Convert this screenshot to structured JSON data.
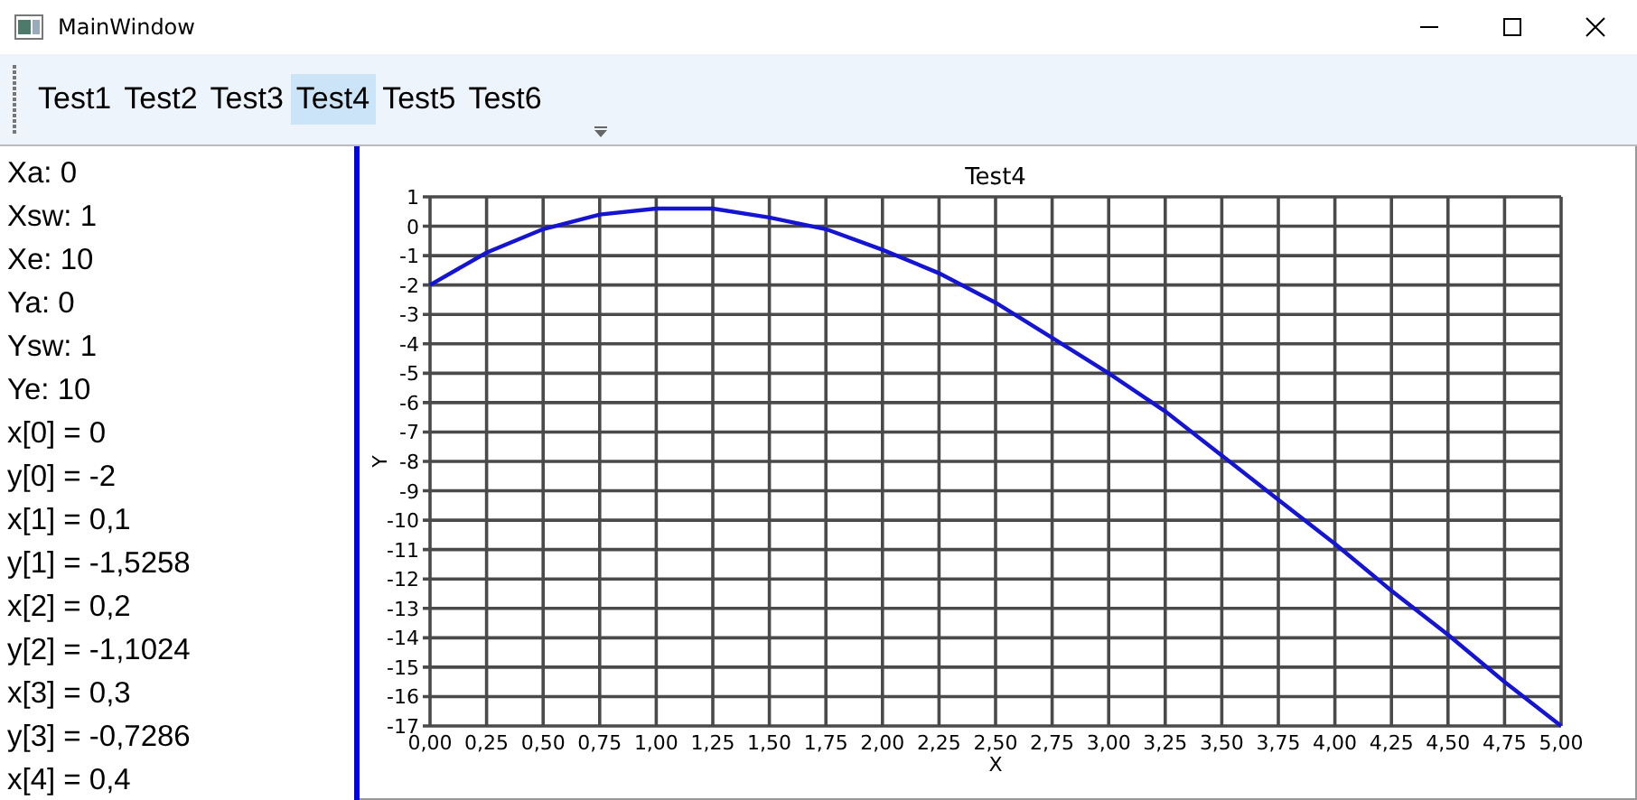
{
  "window": {
    "title": "MainWindow"
  },
  "toolbar": {
    "tabs": [
      {
        "label": "Test1",
        "selected": false
      },
      {
        "label": "Test2",
        "selected": false
      },
      {
        "label": "Test3",
        "selected": false
      },
      {
        "label": "Test4",
        "selected": true
      },
      {
        "label": "Test5",
        "selected": false
      },
      {
        "label": "Test6",
        "selected": false
      }
    ]
  },
  "variables": [
    "Xa: 0",
    "Xsw: 1",
    "Xe: 10",
    "Ya: 0",
    "Ysw: 1",
    "Ye: 10",
    "x[0] = 0",
    "y[0] = -2",
    "x[1] = 0,1",
    "y[1] = -1,5258",
    "x[2] = 0,2",
    "y[2] = -1,1024",
    "x[3] = 0,3",
    "y[3] = -0,7286",
    "x[4] = 0,4"
  ],
  "chart": {
    "chart_data": {
      "type": "line",
      "title": "Test4",
      "xlabel": "X",
      "ylabel": "Y",
      "x": [
        0,
        0.25,
        0.5,
        0.75,
        1,
        1.25,
        1.5,
        1.75,
        2,
        2.25,
        2.5,
        2.75,
        3,
        3.25,
        3.5,
        3.75,
        4,
        4.25,
        4.5,
        4.75,
        5
      ],
      "grid": true,
      "series": [
        {
          "color": "#1414d2",
          "values": [
            -2,
            -0.9,
            -0.1,
            0.4,
            0.6,
            0.6,
            0.3,
            -0.1,
            -0.8,
            -1.6,
            -2.6,
            -3.8,
            -5,
            -6.3,
            -7.8,
            -9.3,
            -10.8,
            -12.4,
            -13.9,
            -15.5,
            -17
          ]
        }
      ],
      "xlim": [
        0,
        5
      ],
      "ylim": [
        -17,
        1
      ],
      "xticks": [
        {
          "value": 0,
          "label": "0,00"
        },
        {
          "value": 0.25,
          "label": "0,25"
        },
        {
          "value": 0.5,
          "label": "0,50"
        },
        {
          "value": 0.75,
          "label": "0,75"
        },
        {
          "value": 1,
          "label": "1,00"
        },
        {
          "value": 1.25,
          "label": "1,25"
        },
        {
          "value": 1.5,
          "label": "1,50"
        },
        {
          "value": 1.75,
          "label": "1,75"
        },
        {
          "value": 2,
          "label": "2,00"
        },
        {
          "value": 2.25,
          "label": "2,25"
        },
        {
          "value": 2.5,
          "label": "2,50"
        },
        {
          "value": 2.75,
          "label": "2,75"
        },
        {
          "value": 3,
          "label": "3,00"
        },
        {
          "value": 3.25,
          "label": "3,25"
        },
        {
          "value": 3.5,
          "label": "3,50"
        },
        {
          "value": 3.75,
          "label": "3,75"
        },
        {
          "value": 4,
          "label": "4,00"
        },
        {
          "value": 4.25,
          "label": "4,25"
        },
        {
          "value": 4.5,
          "label": "4,50"
        },
        {
          "value": 4.75,
          "label": "4,75"
        },
        {
          "value": 5,
          "label": "5,00"
        }
      ],
      "yticks": [
        1,
        0,
        -1,
        -2,
        -3,
        -4,
        -5,
        -6,
        -7,
        -8,
        -9,
        -10,
        -11,
        -12,
        -13,
        -14,
        -15,
        -16,
        -17
      ]
    }
  }
}
